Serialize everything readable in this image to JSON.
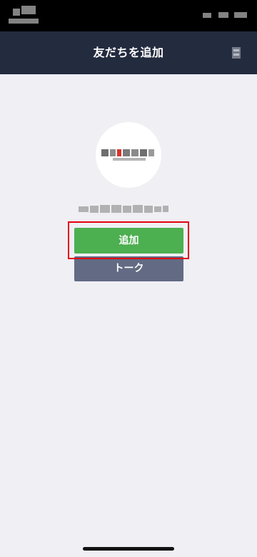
{
  "header": {
    "title": "友だちを追加",
    "right_icon": "more-icon"
  },
  "profile": {
    "avatar_icon": "account-logo-icon",
    "name_obscured": true
  },
  "buttons": {
    "add_label": "追加",
    "talk_label": "トーク"
  },
  "colors": {
    "header_bg": "#232b3f",
    "add_button": "#4caf50",
    "talk_button": "#636b84",
    "highlight": "#e5000f",
    "page_bg": "#efeff4"
  }
}
